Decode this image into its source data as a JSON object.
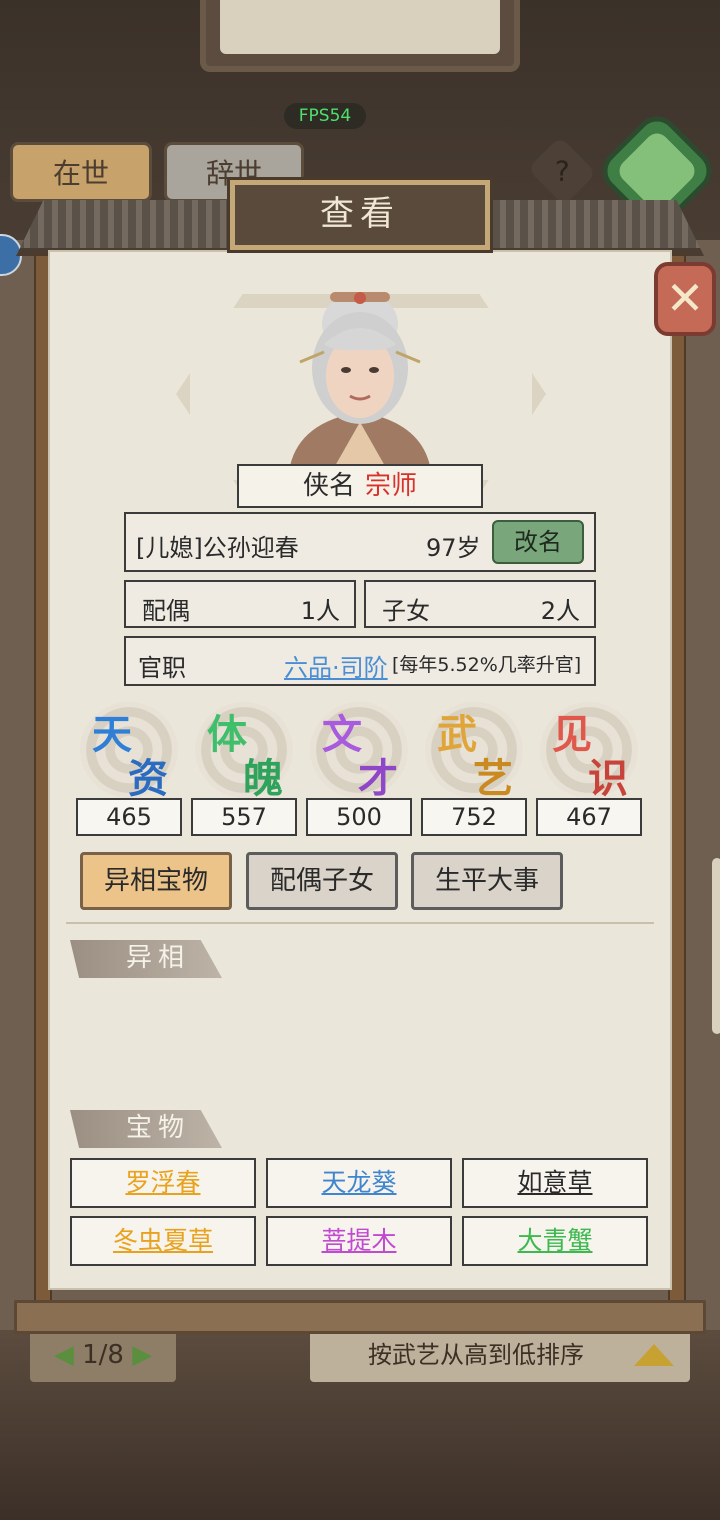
{
  "fps": "FPS54",
  "background": {
    "tabs": [
      "在世",
      "辞世"
    ],
    "help_label": "?",
    "pager": "1/8",
    "sort_label": "按武艺从高到低排序"
  },
  "dialog": {
    "title": "查看",
    "close_icon": "close-x-icon",
    "hero_title_label": "侠名",
    "hero_title_value": "宗师",
    "name": "[儿媳]公孙迎春",
    "age": "97岁",
    "rename_label": "改名",
    "spouse_label": "配偶",
    "spouse_value": "1人",
    "children_label": "子女",
    "children_value": "2人",
    "office_label": "官职",
    "office_rank": "六品·司阶",
    "office_rate": "[每年5.52%几率升官]",
    "stats": [
      {
        "c1": "天",
        "c2": "资",
        "value": "465",
        "color1": "#2f7fd6",
        "color2": "#2b6cc0"
      },
      {
        "c1": "体",
        "c2": "魄",
        "value": "557",
        "color1": "#3fbf6c",
        "color2": "#2fa35b"
      },
      {
        "c1": "文",
        "c2": "才",
        "value": "500",
        "color1": "#a85bdc",
        "color2": "#8f46c7"
      },
      {
        "c1": "武",
        "c2": "艺",
        "value": "752",
        "color1": "#e0a53a",
        "color2": "#c98a22"
      },
      {
        "c1": "见",
        "c2": "识",
        "value": "467",
        "color1": "#e0584c",
        "color2": "#c8443a"
      }
    ],
    "tabs": [
      "异相宝物",
      "配偶子女",
      "生平大事"
    ],
    "section_yixiang": "异相",
    "section_baowu": "宝物",
    "treasures": [
      {
        "name": "罗浮春",
        "color": "#e8a21e"
      },
      {
        "name": "天龙葵",
        "color": "#3f86cf"
      },
      {
        "name": "如意草",
        "color": "#2a2a2a"
      },
      {
        "name": "冬虫夏草",
        "color": "#e8a21e"
      },
      {
        "name": "菩提木",
        "color": "#c24ad0"
      },
      {
        "name": "大青蟹",
        "color": "#3db94f"
      }
    ]
  }
}
